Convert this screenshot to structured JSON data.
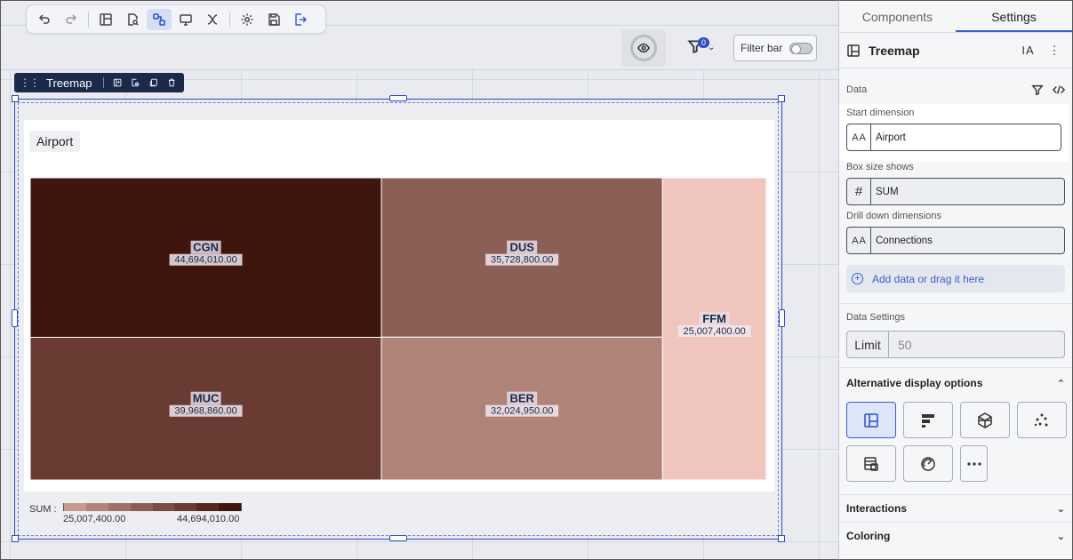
{
  "canvas": {
    "filter_badge": "0",
    "filter_bar_label": "Filter bar"
  },
  "widget": {
    "label": "Treemap",
    "chart_title": "Airport"
  },
  "chart_data": {
    "type": "treemap",
    "title": "Airport",
    "dimension": "Airport",
    "measure": "SUM",
    "nodes": [
      {
        "label": "CGN",
        "value": 44694010.0,
        "display": "44,694,010.00",
        "color": "#3f160e"
      },
      {
        "label": "MUC",
        "value": 39968860.0,
        "display": "39,968,860.00",
        "color": "#6a3b32"
      },
      {
        "label": "DUS",
        "value": 35728800.0,
        "display": "35,728,800.00",
        "color": "#8c5f56"
      },
      {
        "label": "BER",
        "value": 32024950.0,
        "display": "32,024,950.00",
        "color": "#b08378"
      },
      {
        "label": "FFM",
        "value": 25007400.0,
        "display": "25,007,400.00",
        "color": "#f0c5bd"
      }
    ],
    "legend": {
      "title": "SUM :",
      "min": "25,007,400.00",
      "max": "44,694,010.00",
      "colors": [
        "#c79a90",
        "#b08378",
        "#9c7167",
        "#8c5f56",
        "#7a4c43",
        "#6a3b32",
        "#552920",
        "#3f160e"
      ]
    }
  },
  "panel": {
    "tabs": [
      "Components",
      "Settings"
    ],
    "header_title": "Treemap",
    "data_section": "Data",
    "start_dimension_label": "Start dimension",
    "start_dimension_value": "Airport",
    "box_size_label": "Box size shows",
    "box_size_value": "SUM",
    "drill_label": "Drill down dimensions",
    "drill_value": "Connections",
    "add_data": "Add data or drag it here",
    "data_settings": "Data Settings",
    "limit_label": "Limit",
    "limit_placeholder": "50",
    "alt_display": "Alternative display options",
    "interactions": "Interactions",
    "coloring": "Coloring"
  }
}
